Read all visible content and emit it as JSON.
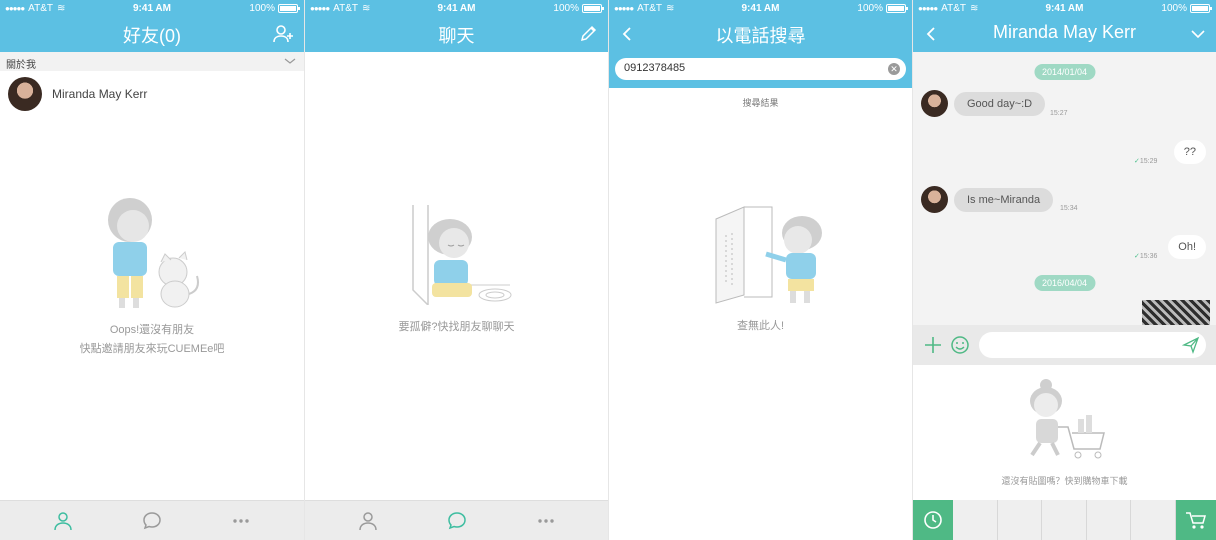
{
  "status": {
    "carrier": "AT&T",
    "time": "9:41 AM",
    "battery": "100%"
  },
  "screens": {
    "friends": {
      "title": "好友(0)",
      "section": "關於我",
      "me_name": "Miranda May Kerr",
      "empty_line1": "Oops!還沒有朋友",
      "empty_line2": "快點邀請朋友來玩CUEMEe吧",
      "active_tab": "friends"
    },
    "chat_list": {
      "title": "聊天",
      "empty_text": "要孤僻?快找朋友聊聊天",
      "active_tab": "chats"
    },
    "phone_search": {
      "title": "以電話搜尋",
      "query": "0912378485",
      "results_label": "搜尋結果",
      "empty_text": "查無此人!"
    },
    "conversation": {
      "title": "Miranda May Kerr",
      "messages": [
        {
          "type": "date",
          "text": "2014/01/04"
        },
        {
          "type": "in",
          "text": "Good day~:D",
          "time": "15:27"
        },
        {
          "type": "out",
          "text": "??",
          "time": "15:29"
        },
        {
          "type": "in",
          "text": "Is me~Miranda",
          "time": "15:34"
        },
        {
          "type": "out",
          "text": "Oh!",
          "time": "15:36"
        },
        {
          "type": "date",
          "text": "2016/04/04"
        }
      ],
      "sticker_empty": "還沒有貼圖嗎？快到購物車下載"
    }
  },
  "colors": {
    "header": "#5cc0e3",
    "accent_green": "#4fb985",
    "tab_active": "#3dbda0",
    "tab_inactive": "#9a9a9a"
  }
}
